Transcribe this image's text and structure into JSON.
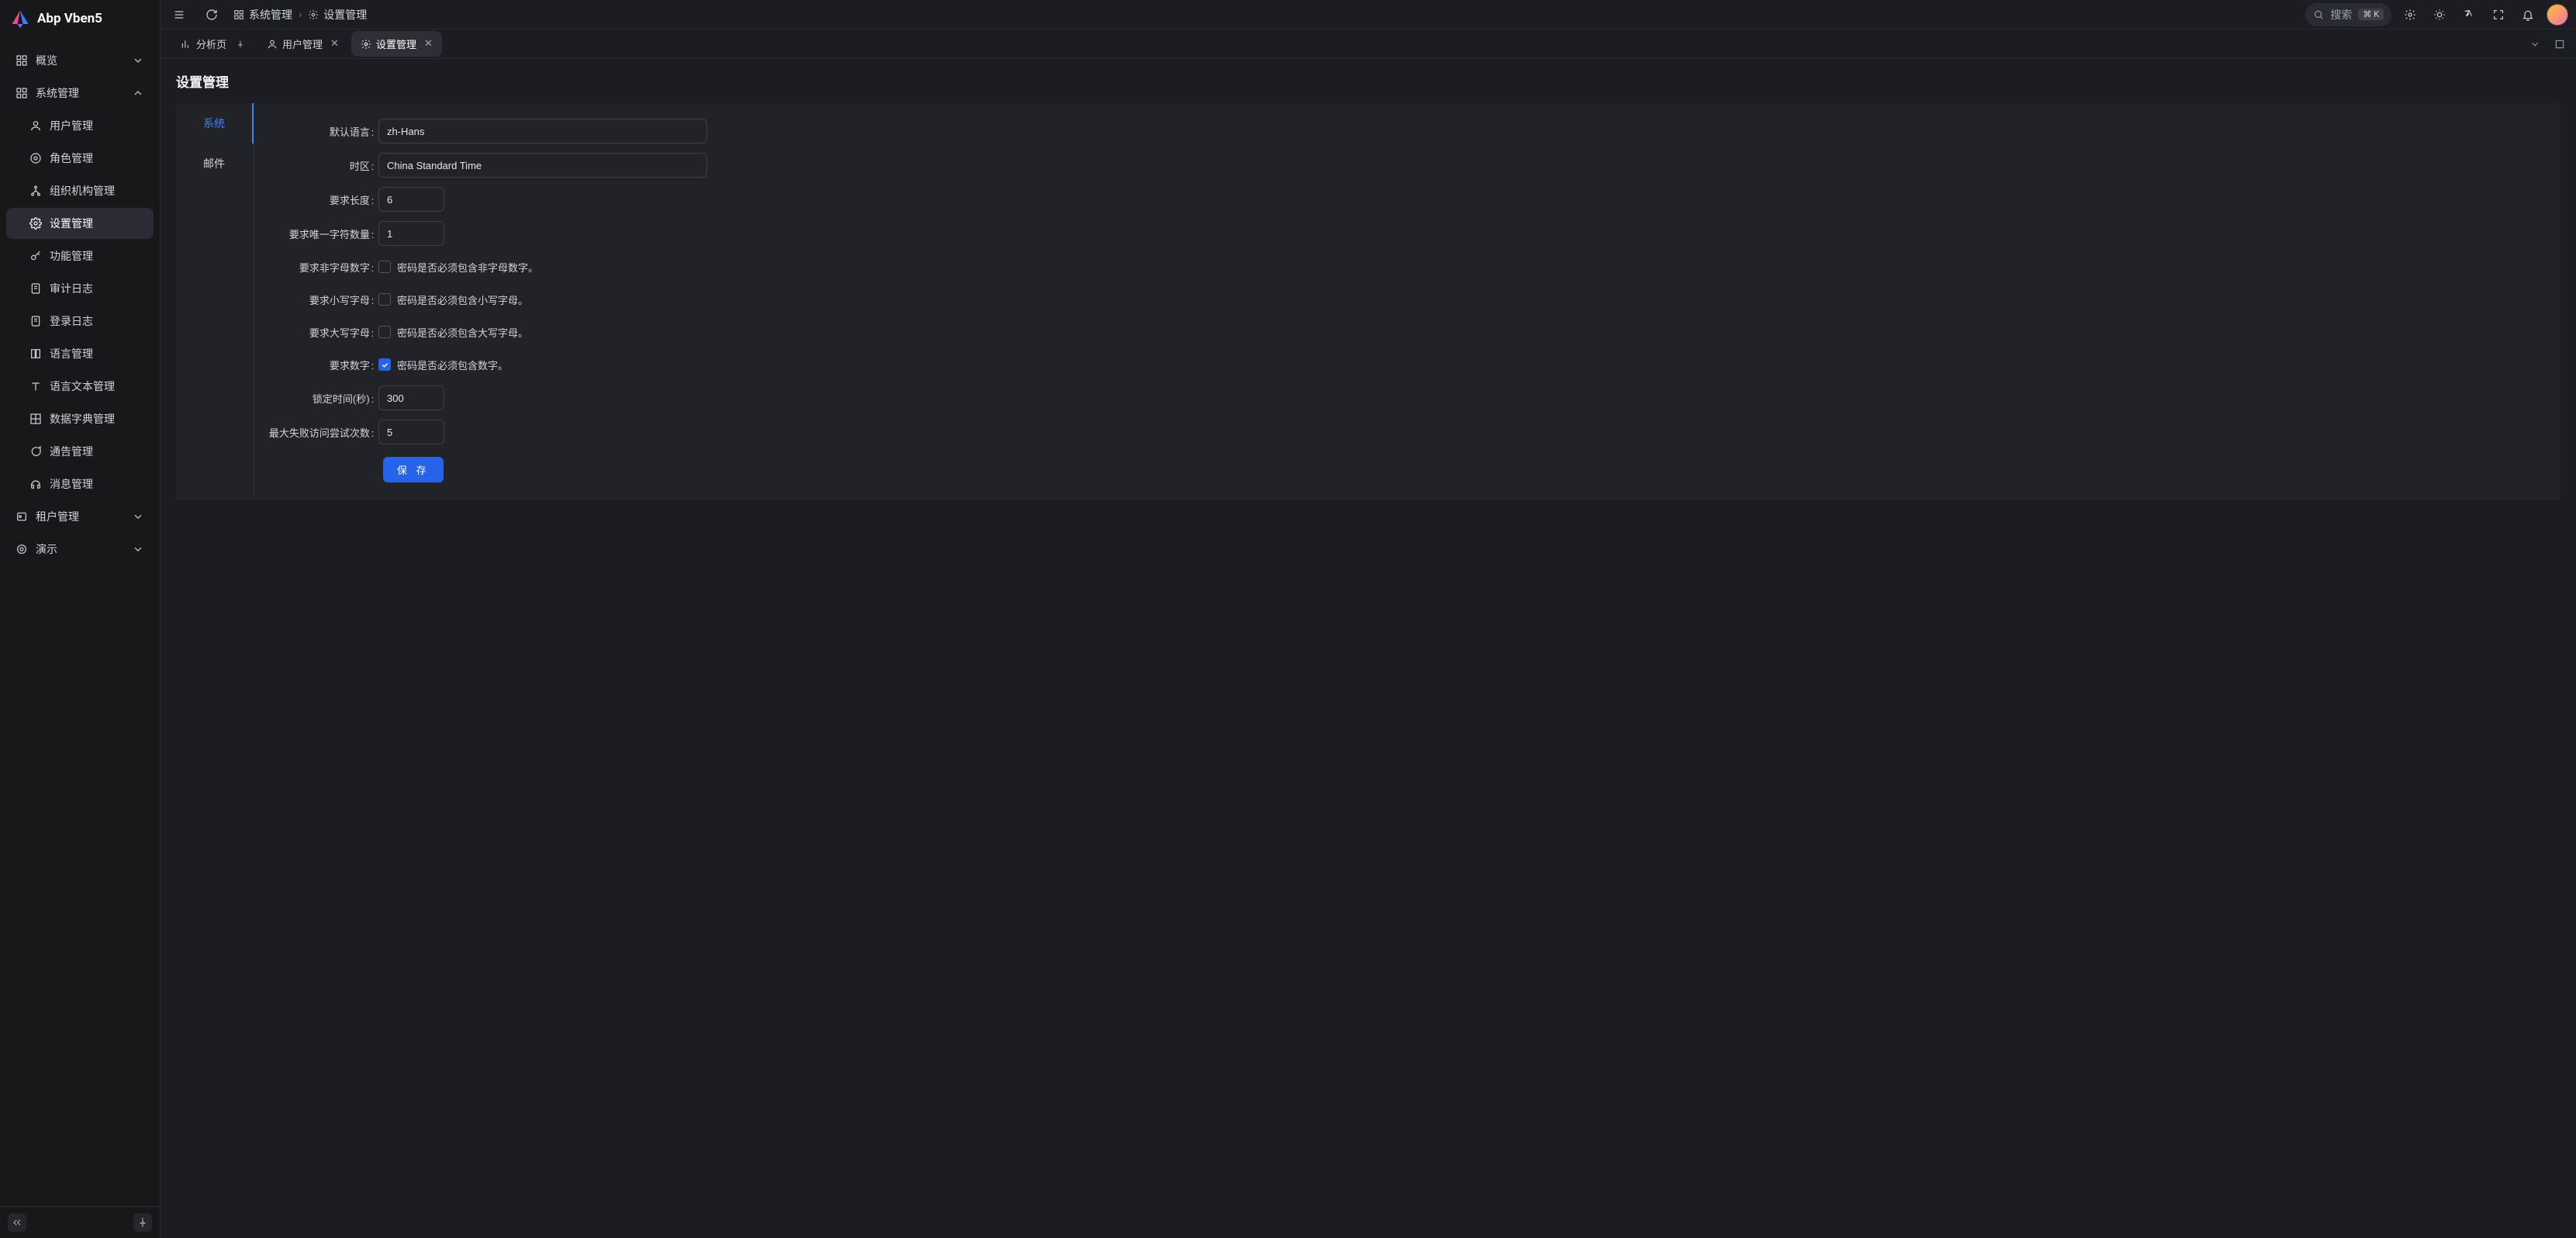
{
  "app": {
    "name": "Abp Vben5"
  },
  "sidebar": {
    "items": [
      {
        "label": "概览",
        "icon": "grid"
      },
      {
        "label": "系统管理",
        "icon": "grid",
        "expanded": true
      },
      {
        "label": "用户管理",
        "icon": "user"
      },
      {
        "label": "角色管理",
        "icon": "gear-round"
      },
      {
        "label": "组织机构管理",
        "icon": "org"
      },
      {
        "label": "设置管理",
        "icon": "gear"
      },
      {
        "label": "功能管理",
        "icon": "key"
      },
      {
        "label": "审计日志",
        "icon": "file"
      },
      {
        "label": "登录日志",
        "icon": "file"
      },
      {
        "label": "语言管理",
        "icon": "book"
      },
      {
        "label": "语言文本管理",
        "icon": "type"
      },
      {
        "label": "数据字典管理",
        "icon": "grid2"
      },
      {
        "label": "通告管理",
        "icon": "chat"
      },
      {
        "label": "消息管理",
        "icon": "headphones"
      },
      {
        "label": "租户管理",
        "icon": "badge"
      },
      {
        "label": "演示",
        "icon": "target"
      }
    ]
  },
  "breadcrumb": {
    "items": [
      {
        "label": "系统管理"
      },
      {
        "label": "设置管理"
      }
    ]
  },
  "search": {
    "placeholder": "搜索",
    "shortcut": "⌘ K"
  },
  "tabs": {
    "items": [
      {
        "label": "分析页",
        "icon": "chart",
        "pinned": true
      },
      {
        "label": "用户管理",
        "icon": "user",
        "closable": true
      },
      {
        "label": "设置管理",
        "icon": "gear",
        "closable": true,
        "active": true
      }
    ]
  },
  "page": {
    "title": "设置管理"
  },
  "sideTabs": {
    "items": [
      {
        "label": "系统",
        "active": true
      },
      {
        "label": "邮件"
      }
    ]
  },
  "form": {
    "defaultLanguage": {
      "label": "默认语言",
      "value": "zh-Hans"
    },
    "timezone": {
      "label": "时区",
      "value": "China Standard Time"
    },
    "requiredLength": {
      "label": "要求长度",
      "value": "6"
    },
    "requiredUniqueChars": {
      "label": "要求唯一字符数量",
      "value": "1"
    },
    "requireNonAlphanumeric": {
      "label": "要求非字母数字",
      "desc": "密码是否必须包含非字母数字。",
      "checked": false
    },
    "requireLowercase": {
      "label": "要求小写字母",
      "desc": "密码是否必须包含小写字母。",
      "checked": false
    },
    "requireUppercase": {
      "label": "要求大写字母",
      "desc": "密码是否必须包含大写字母。",
      "checked": false
    },
    "requireDigit": {
      "label": "要求数字",
      "desc": "密码是否必须包含数字。",
      "checked": true
    },
    "lockoutDuration": {
      "label": "锁定时间(秒)",
      "value": "300"
    },
    "maxFailedAttempts": {
      "label": "最大失败访问尝试次数",
      "value": "5"
    },
    "saveLabel": "保 存"
  }
}
